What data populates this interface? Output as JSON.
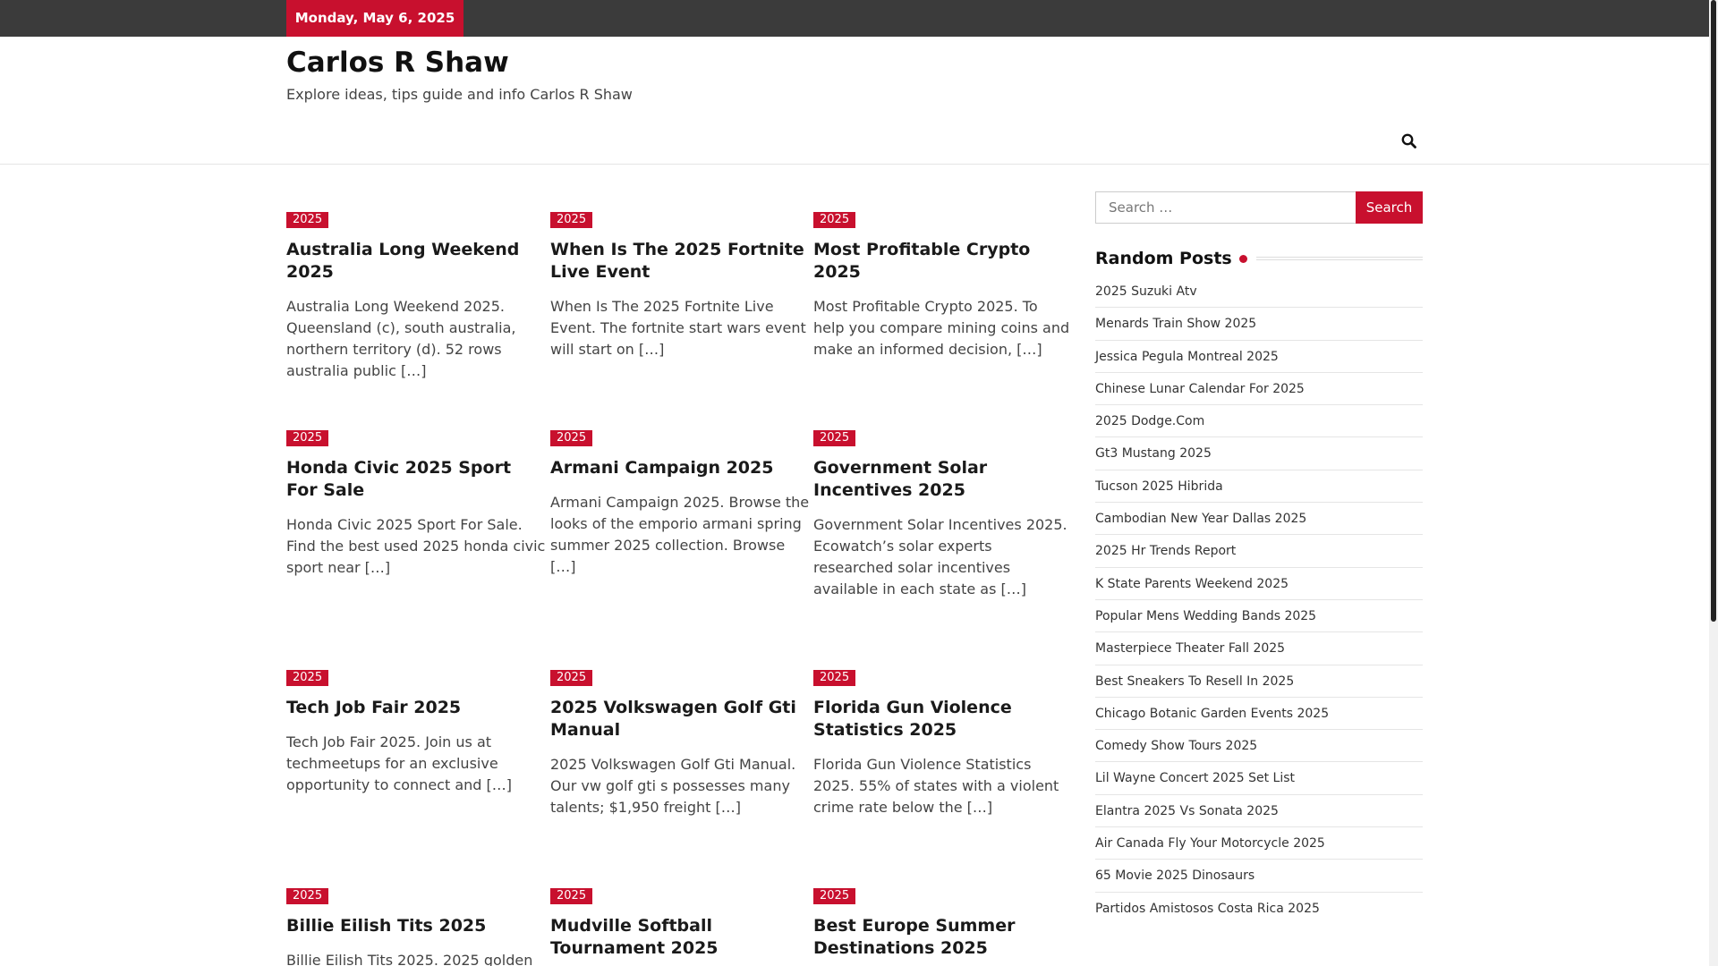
{
  "header": {
    "date": "Monday, May 6, 2025",
    "site_title": "Carlos R Shaw",
    "tagline": "Explore ideas, tips guide and info Carlos R Shaw",
    "search_icon": "search-icon"
  },
  "posts": [
    {
      "category": "2025",
      "title": "Australia Long Weekend 2025",
      "excerpt": "Australia Long Weekend 2025. Queensland (c), south australia, northern territory (d). 52 rows australia public […]"
    },
    {
      "category": "2025",
      "title": "When Is The 2025 Fortnite Live Event",
      "excerpt": "When Is The 2025 Fortnite Live Event. The fortnite start wars event will start on […]"
    },
    {
      "category": "2025",
      "title": "Most Profitable Crypto 2025",
      "excerpt": "Most Profitable Crypto 2025. To help you compare mining coins and make an informed decision, […]"
    },
    {
      "category": "2025",
      "title": "Honda Civic 2025 Sport For Sale",
      "excerpt": "Honda Civic 2025 Sport For Sale. Find the best used 2025 honda civic sport near […]"
    },
    {
      "category": "2025",
      "title": "Armani Campaign 2025",
      "excerpt": "Armani Campaign 2025. Browse the looks of the emporio armani spring summer 2025 collection. Browse […]"
    },
    {
      "category": "2025",
      "title": "Government Solar Incentives 2025",
      "excerpt": "Government Solar Incentives 2025. Ecowatch’s solar experts researched solar incentives available in each state as […]"
    },
    {
      "category": "2025",
      "title": "Tech Job Fair 2025",
      "excerpt": "Tech Job Fair 2025. Join us at techmeetups for an exclusive opportunity to connect and […]"
    },
    {
      "category": "2025",
      "title": "2025 Volkswagen Golf Gti Manual",
      "excerpt": "2025 Volkswagen Golf Gti Manual. Our vw golf gti s possesses many talents; $1,950 freight […]"
    },
    {
      "category": "2025",
      "title": "Florida Gun Violence Statistics 2025",
      "excerpt": "Florida Gun Violence Statistics 2025. 55% of states with a violent crime rate below the […]"
    },
    {
      "category": "2025",
      "title": "Billie Eilish Tits 2025",
      "excerpt": "Billie Eilish Tits 2025. 2025 golden"
    },
    {
      "category": "2025",
      "title": "Mudville Softball Tournament 2025",
      "excerpt": ""
    },
    {
      "category": "2025",
      "title": "Best Europe Summer Destinations 2025",
      "excerpt": ""
    }
  ],
  "sidebar": {
    "search_placeholder": "Search …",
    "search_button": "Search",
    "widget_title": "Random Posts",
    "random_posts": [
      "2025 Suzuki Atv",
      "Menards Train Show 2025",
      "Jessica Pegula Montreal 2025",
      "Chinese Lunar Calendar For 2025",
      "2025 Dodge.Com",
      "Gt3 Mustang 2025",
      "Tucson 2025 Hibrida",
      "Cambodian New Year Dallas 2025",
      "2025 Hr Trends Report",
      "K State Parents Weekend 2025",
      "Popular Mens Wedding Bands 2025",
      "Masterpiece Theater Fall 2025",
      "Best Sneakers To Resell In 2025",
      "Chicago Botanic Garden Events 2025",
      "Comedy Show Tours 2025",
      "Lil Wayne Concert 2025 Set List",
      "Elantra 2025 Vs Sonata 2025",
      "Air Canada Fly Your Motorcycle 2025",
      "65 Movie 2025 Dinosaurs",
      "Partidos Amistosos Costa Rica 2025"
    ]
  },
  "colors": {
    "accent": "#c8102e",
    "topbar": "#3b3b3b"
  }
}
